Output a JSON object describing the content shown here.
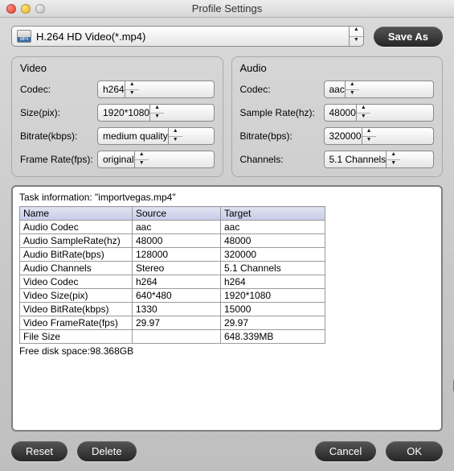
{
  "window": {
    "title": "Profile Settings"
  },
  "profile": {
    "label": "H.264 HD Video(*.mp4)",
    "save_as": "Save As"
  },
  "video": {
    "title": "Video",
    "codec_label": "Codec:",
    "codec": "h264",
    "size_label": "Size(pix):",
    "size": "1920*1080",
    "bitrate_label": "Bitrate(kbps):",
    "bitrate": "medium quality",
    "fps_label": "Frame Rate(fps):",
    "fps": "original"
  },
  "audio": {
    "title": "Audio",
    "codec_label": "Codec:",
    "codec": "aac",
    "sr_label": "Sample Rate(hz):",
    "sr": "48000",
    "bitrate_label": "Bitrate(bps):",
    "bitrate": "320000",
    "channels_label": "Channels:",
    "channels": "5.1 Channels"
  },
  "task": {
    "heading": "Task information: \"importvegas.mp4\"",
    "columns": [
      "Name",
      "Source",
      "Target"
    ],
    "rows": [
      [
        "Audio Codec",
        "aac",
        "aac"
      ],
      [
        "Audio SampleRate(hz)",
        "48000",
        "48000"
      ],
      [
        "Audio BitRate(bps)",
        "128000",
        "320000"
      ],
      [
        "Audio Channels",
        "Stereo",
        "5.1 Channels"
      ],
      [
        "Video Codec",
        "h264",
        "h264"
      ],
      [
        "Video Size(pix)",
        "640*480",
        "1920*1080"
      ],
      [
        "Video BitRate(kbps)",
        "1330",
        "15000"
      ],
      [
        "Video FrameRate(fps)",
        "29.97",
        "29.97"
      ],
      [
        "File Size",
        "",
        "648.339MB"
      ]
    ],
    "free_space": "Free disk space:98.368GB"
  },
  "buttons": {
    "reset": "Reset",
    "delete": "Delete",
    "cancel": "Cancel",
    "ok": "OK"
  }
}
